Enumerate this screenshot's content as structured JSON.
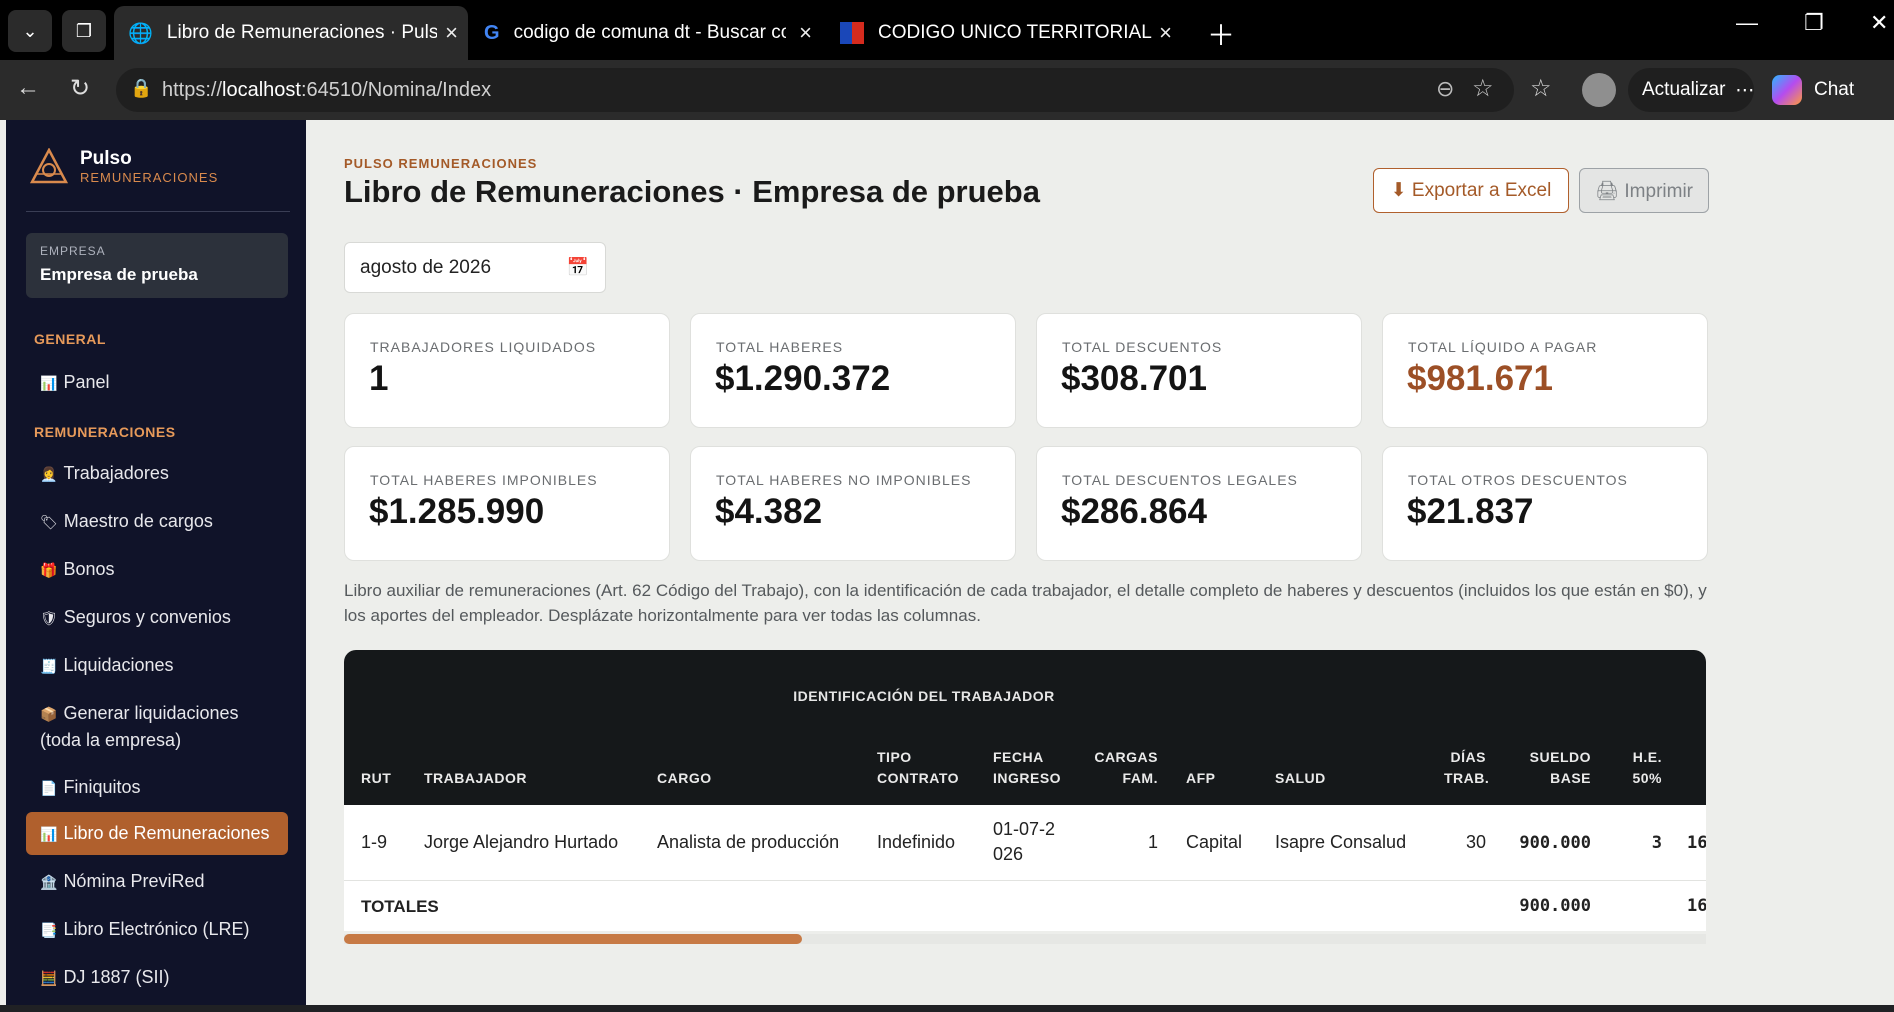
{
  "browser": {
    "tabs": [
      {
        "title": "Libro de Remuneraciones · Pulso Re",
        "icon": "globe-icon"
      },
      {
        "title": "codigo de comuna dt - Buscar con",
        "icon": "google-icon"
      },
      {
        "title": "CODIGO UNICO TERRITORIAL",
        "icon": "flag-icon"
      }
    ],
    "url_scheme": "https://",
    "url_host": "localhost",
    "url_rest": ":64510/Nomina/Index",
    "update_label": "Actualizar",
    "chat_label": "Chat"
  },
  "sidebar": {
    "brand_name": "Pulso",
    "brand_sub": "REMUNERACIONES",
    "empresa_label": "EMPRESA",
    "empresa_value": "Empresa de prueba",
    "section_general": "GENERAL",
    "section_remuneraciones": "REMUNERACIONES",
    "items": [
      {
        "icon": "📊",
        "label": "Panel"
      },
      {
        "icon": "👩‍💼",
        "label": "Trabajadores"
      },
      {
        "icon": "🏷",
        "label": "Maestro de cargos"
      },
      {
        "icon": "🎁",
        "label": "Bonos"
      },
      {
        "icon": "🛡",
        "label": "Seguros y convenios"
      },
      {
        "icon": "🧾",
        "label": "Liquidaciones"
      },
      {
        "icon": "📦",
        "label": "Generar liquidaciones (toda la empresa)"
      },
      {
        "icon": "📄",
        "label": "Finiquitos"
      },
      {
        "icon": "📊",
        "label": "Libro de Remuneraciones"
      },
      {
        "icon": "🏦",
        "label": "Nómina PreviRed"
      },
      {
        "icon": "📑",
        "label": "Libro Electrónico (LRE)"
      },
      {
        "icon": "🧮",
        "label": "DJ 1887 (SII)"
      }
    ]
  },
  "header": {
    "eyebrow": "PULSO REMUNERACIONES",
    "title": "Libro de Remuneraciones · Empresa de prueba",
    "export_label": "⬇ Exportar a Excel",
    "print_label": "🖨 Imprimir",
    "period": "agosto de 2026"
  },
  "cards": [
    {
      "label": "TRABAJADORES LIQUIDADOS",
      "value": "1"
    },
    {
      "label": "TOTAL HABERES",
      "value": "$1.290.372"
    },
    {
      "label": "TOTAL DESCUENTOS",
      "value": "$308.701"
    },
    {
      "label": "TOTAL LÍQUIDO A PAGAR",
      "value": "$981.671"
    },
    {
      "label": "TOTAL HABERES IMPONIBLES",
      "value": "$1.285.990"
    },
    {
      "label": "TOTAL HABERES NO IMPONIBLES",
      "value": "$4.382"
    },
    {
      "label": "TOTAL DESCUENTOS LEGALES",
      "value": "$286.864"
    },
    {
      "label": "TOTAL OTROS DESCUENTOS",
      "value": "$21.837"
    }
  ],
  "description": "Libro auxiliar de remuneraciones (Art. 62 Código del Trabajo), con la identificación de cada trabajador, el detalle completo de haberes y descuentos (incluidos los que están en $0), y los aportes del empleador. Desplázate horizontalmente para ver todas las columnas.",
  "table": {
    "group_header": "IDENTIFICACIÓN DEL TRABAJADOR",
    "columns": [
      "RUT",
      "TRABAJADOR",
      "CARGO",
      "TIPO CONTRATO",
      "FECHA INGRESO",
      "CARGAS FAM.",
      "AFP",
      "SALUD",
      "DÍAS TRAB.",
      "SUELDO BASE",
      "H.E. 50%"
    ],
    "rows": [
      {
        "rut": "1-9",
        "trabajador": "Jorge Alejandro Hurtado",
        "cargo": "Analista de producción",
        "tipo_contrato": "Indefinido",
        "fecha_ingreso": "01-07-2026",
        "cargas": "1",
        "afp": "Capital",
        "salud": "Isapre Consalud",
        "dias": "30",
        "sueldo_base": "900.000",
        "he50": "3",
        "next": "16"
      }
    ],
    "totals_label": "TOTALES",
    "totals_sueldo_base": "900.000",
    "totals_next": "16"
  }
}
